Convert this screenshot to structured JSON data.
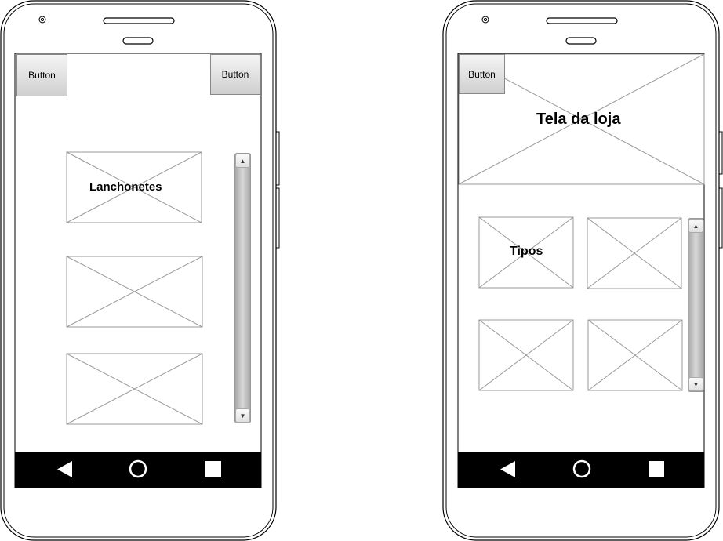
{
  "phone_left": {
    "button_left": "Button",
    "button_right": "Button",
    "placeholder_label": "Lanchonetes"
  },
  "phone_right": {
    "button_left": "Button",
    "header_title": "Tela da loja",
    "placeholder_label": "Tipos"
  },
  "icons": {
    "scroll_up": "▲",
    "scroll_down": "▼"
  }
}
